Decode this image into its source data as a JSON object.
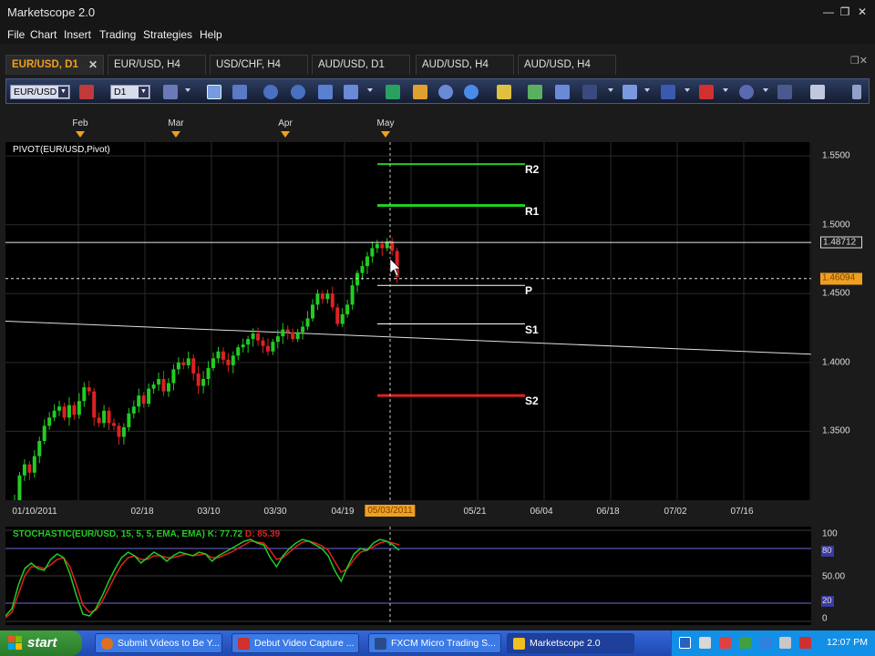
{
  "window": {
    "title": "Marketscope 2.0",
    "buttons": [
      "minimize-icon",
      "restore-icon",
      "close-icon"
    ]
  },
  "menu": [
    "File",
    "Chart",
    "Insert",
    "Trading",
    "Strategies",
    "Help"
  ],
  "tabs": [
    "EUR/USD, D1",
    "EUR/USD, H4",
    "USD/CHF, H4",
    "AUD/USD, D1",
    "AUD/USD, H4",
    "AUD/USD, H4"
  ],
  "toolbar": {
    "symbol": "EUR/USD",
    "period": "D1"
  },
  "chart": {
    "indicator_label": "PIVOT(EUR/USD,Pivot)",
    "months": [
      "Feb",
      "Mar",
      "Apr",
      "May"
    ],
    "dates": [
      "01/10/2011",
      "02/18",
      "03/10",
      "03/30",
      "04/19",
      "05/21",
      "06/04",
      "06/18",
      "07/02",
      "07/16"
    ],
    "cursor_date": "05/03/2011",
    "price_ticks": [
      "1.5500",
      "1.5000",
      "1.4500",
      "1.4000",
      "1.3500"
    ],
    "price_tag_1": "1.48712",
    "price_tag_2": "1.46094",
    "pivots": [
      "R2",
      "R1",
      "P",
      "S1",
      "S2"
    ],
    "colors": {
      "bull": "#22cc22",
      "bear": "#dd2222",
      "r": "#22cc22",
      "s": "#dd2222",
      "pivot": "#ffffff",
      "accent": "#f0a020"
    }
  },
  "chart_data": {
    "type": "candlestick",
    "title": "PIVOT(EUR/USD,Pivot)",
    "ylim": [
      1.3,
      1.56
    ],
    "pivot_levels": {
      "R2": 1.544,
      "R1": 1.514,
      "P": 1.456,
      "S1": 1.428,
      "S2": 1.376
    },
    "trendline": [
      [
        1.43,
        1.406
      ]
    ],
    "closes": [
      1.3,
      1.318,
      1.326,
      1.32,
      1.332,
      1.343,
      1.354,
      1.36,
      1.365,
      1.368,
      1.36,
      1.369,
      1.362,
      1.372,
      1.382,
      1.379,
      1.36,
      1.356,
      1.365,
      1.356,
      1.354,
      1.346,
      1.353,
      1.363,
      1.368,
      1.376,
      1.37,
      1.381,
      1.384,
      1.388,
      1.379,
      1.385,
      1.395,
      1.4,
      1.398,
      1.403,
      1.392,
      1.383,
      1.388,
      1.396,
      1.403,
      1.408,
      1.402,
      1.398,
      1.405,
      1.411,
      1.413,
      1.417,
      1.421,
      1.416,
      1.412,
      1.408,
      1.415,
      1.419,
      1.424,
      1.422,
      1.417,
      1.422,
      1.426,
      1.432,
      1.442,
      1.45,
      1.446,
      1.45,
      1.44,
      1.428,
      1.435,
      1.442,
      1.456,
      1.465,
      1.47,
      1.477,
      1.483,
      1.486,
      1.483,
      1.488,
      1.481,
      1.462
    ],
    "stochastic": {
      "title": "STOCHASTIC(EUR/USD, 15, 5, 5, EMA, EMA)",
      "k_label": "K: 77.72",
      "d_label": "D: 85.39",
      "ticks": [
        "100",
        "80",
        "50.00",
        "20",
        "0"
      ],
      "k": [
        6,
        14,
        40,
        58,
        64,
        58,
        56,
        68,
        74,
        70,
        52,
        28,
        8,
        6,
        14,
        28,
        44,
        58,
        70,
        76,
        72,
        64,
        70,
        76,
        72,
        66,
        72,
        76,
        74,
        72,
        76,
        74,
        66,
        72,
        76,
        80,
        84,
        88,
        90,
        86,
        84,
        70,
        60,
        72,
        80,
        86,
        90,
        88,
        84,
        80,
        72,
        56,
        44,
        60,
        74,
        80,
        78,
        86,
        90,
        88,
        84,
        78
      ],
      "d": [
        4,
        10,
        30,
        50,
        60,
        60,
        58,
        62,
        68,
        70,
        60,
        40,
        18,
        10,
        12,
        22,
        36,
        50,
        62,
        70,
        72,
        68,
        68,
        72,
        72,
        70,
        70,
        72,
        74,
        72,
        73,
        74,
        70,
        70,
        73,
        76,
        80,
        84,
        88,
        87,
        86,
        78,
        68,
        70,
        76,
        82,
        87,
        88,
        86,
        83,
        78,
        66,
        54,
        58,
        68,
        76,
        78,
        82,
        86,
        88,
        86,
        84
      ]
    }
  },
  "taskbar": {
    "start": "start",
    "tasks": [
      "Submit Videos to Be Y...",
      "Debut Video Capture ...",
      "FXCM Micro Trading S...",
      "Marketscope 2.0"
    ],
    "clock": "12:07 PM"
  }
}
